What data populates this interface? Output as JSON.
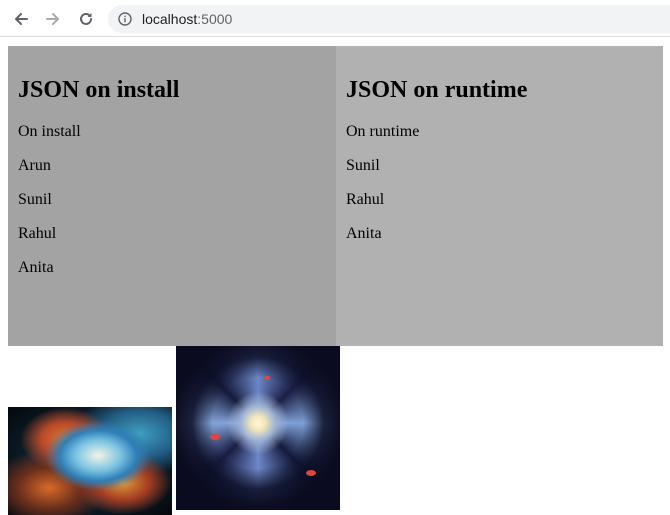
{
  "browser": {
    "url_host": "localhost",
    "url_port": ":5000",
    "icons": [
      "back-arrow-icon",
      "forward-arrow-icon",
      "reload-icon",
      "info-icon"
    ],
    "colors": {
      "omnibox_bg": "#f1f3f4"
    }
  },
  "panels": {
    "left": {
      "title": "JSON on install",
      "items": [
        "On install",
        "Arun",
        "Sunil",
        "Rahul",
        "Anita"
      ],
      "bg": "#a3a3a3"
    },
    "right": {
      "title": "JSON on runtime",
      "items": [
        "On runtime",
        "Sunil",
        "Rahul",
        "Anita"
      ],
      "bg": "#b1b1b1"
    }
  },
  "images": [
    {
      "subject": "crab-nebula"
    },
    {
      "subject": "pinwheel-galaxy"
    }
  ]
}
